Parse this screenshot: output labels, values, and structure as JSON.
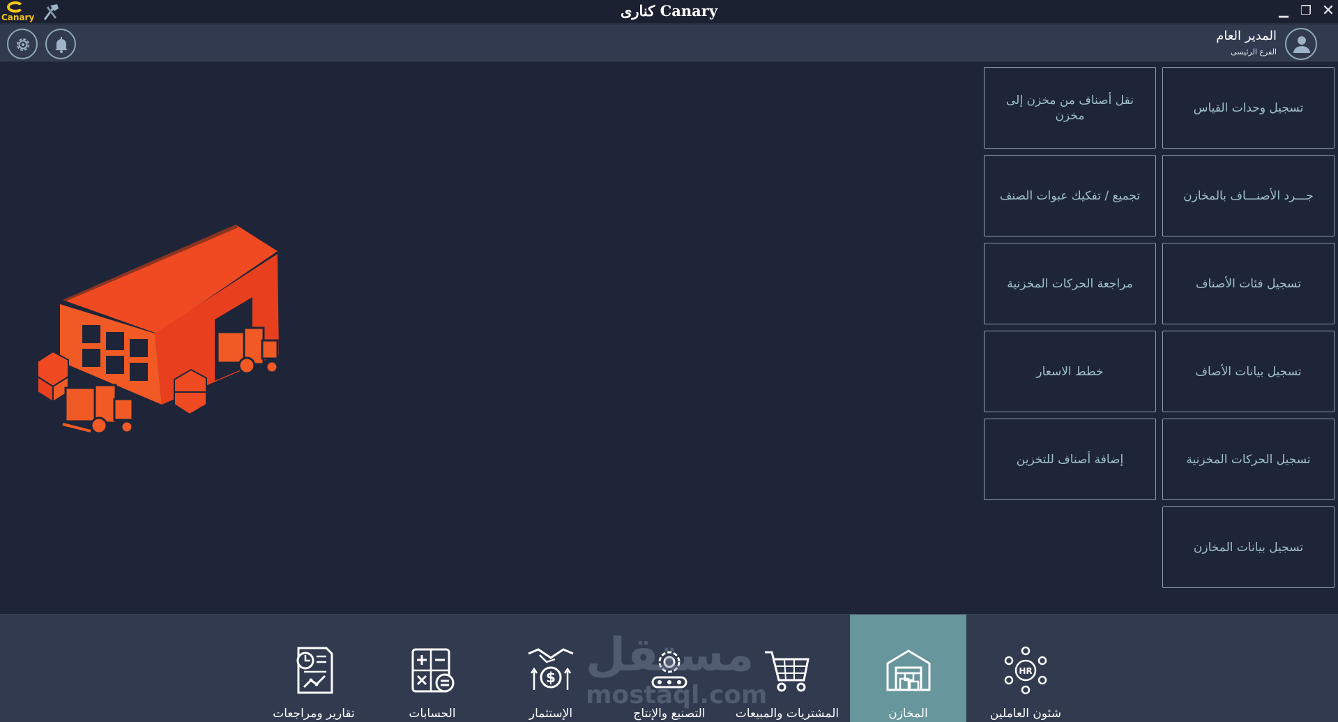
{
  "titlebar": {
    "logo_text": "Canary",
    "title": "كنارى Canary",
    "minimize": "▁",
    "maximize": "❐",
    "close": "✕"
  },
  "header": {
    "user_name": "المدير العام",
    "branch": "الفرع الرئيسى",
    "icons": [
      "settings-icon",
      "bell-icon",
      "user-avatar-icon"
    ]
  },
  "menu": {
    "items": [
      {
        "label": "تسجيل وحدات القياس"
      },
      {
        "label": "نقل أصناف من مخزن إلى مخزن"
      },
      {
        "label": "جـــرد الأصنـــاف بالمخازن"
      },
      {
        "label": "تجميع / تفكيك عبوات الصنف"
      },
      {
        "label": "تسجيل فئات الأصناف"
      },
      {
        "label": "مراجعة الحركات المخزنية"
      },
      {
        "label": "تسجيل بيانات الأصاف"
      },
      {
        "label": "خطط الاسعار"
      },
      {
        "label": "تسجيل الحركات المخزنية"
      },
      {
        "label": "إضافة أصناف للتخزين"
      },
      {
        "label": "تسجيل بيانات المخازن"
      }
    ]
  },
  "bottom_nav": {
    "items": [
      {
        "label": "شئون العاملين",
        "icon": "hr-icon",
        "active": false
      },
      {
        "label": "المخازن",
        "icon": "warehouse-icon",
        "active": true
      },
      {
        "label": "المشتريات والمبيعات",
        "icon": "cart-icon",
        "active": false
      },
      {
        "label": "التصنيع والإنتاج",
        "icon": "gear-conveyor-icon",
        "active": false
      },
      {
        "label": "الإستثمار",
        "icon": "investment-icon",
        "active": false
      },
      {
        "label": "الحسابات",
        "icon": "calculator-icon",
        "active": false
      },
      {
        "label": "تقارير ومراجعات",
        "icon": "report-icon",
        "active": false
      }
    ]
  },
  "watermark": {
    "arabic": "مستقل",
    "latin": "mostaql.com"
  },
  "colors": {
    "background": "#1e2538",
    "header": "#313a4f",
    "active_tab": "#67969c",
    "accent": "#f04a23",
    "menu_text": "#9fc0cc"
  }
}
